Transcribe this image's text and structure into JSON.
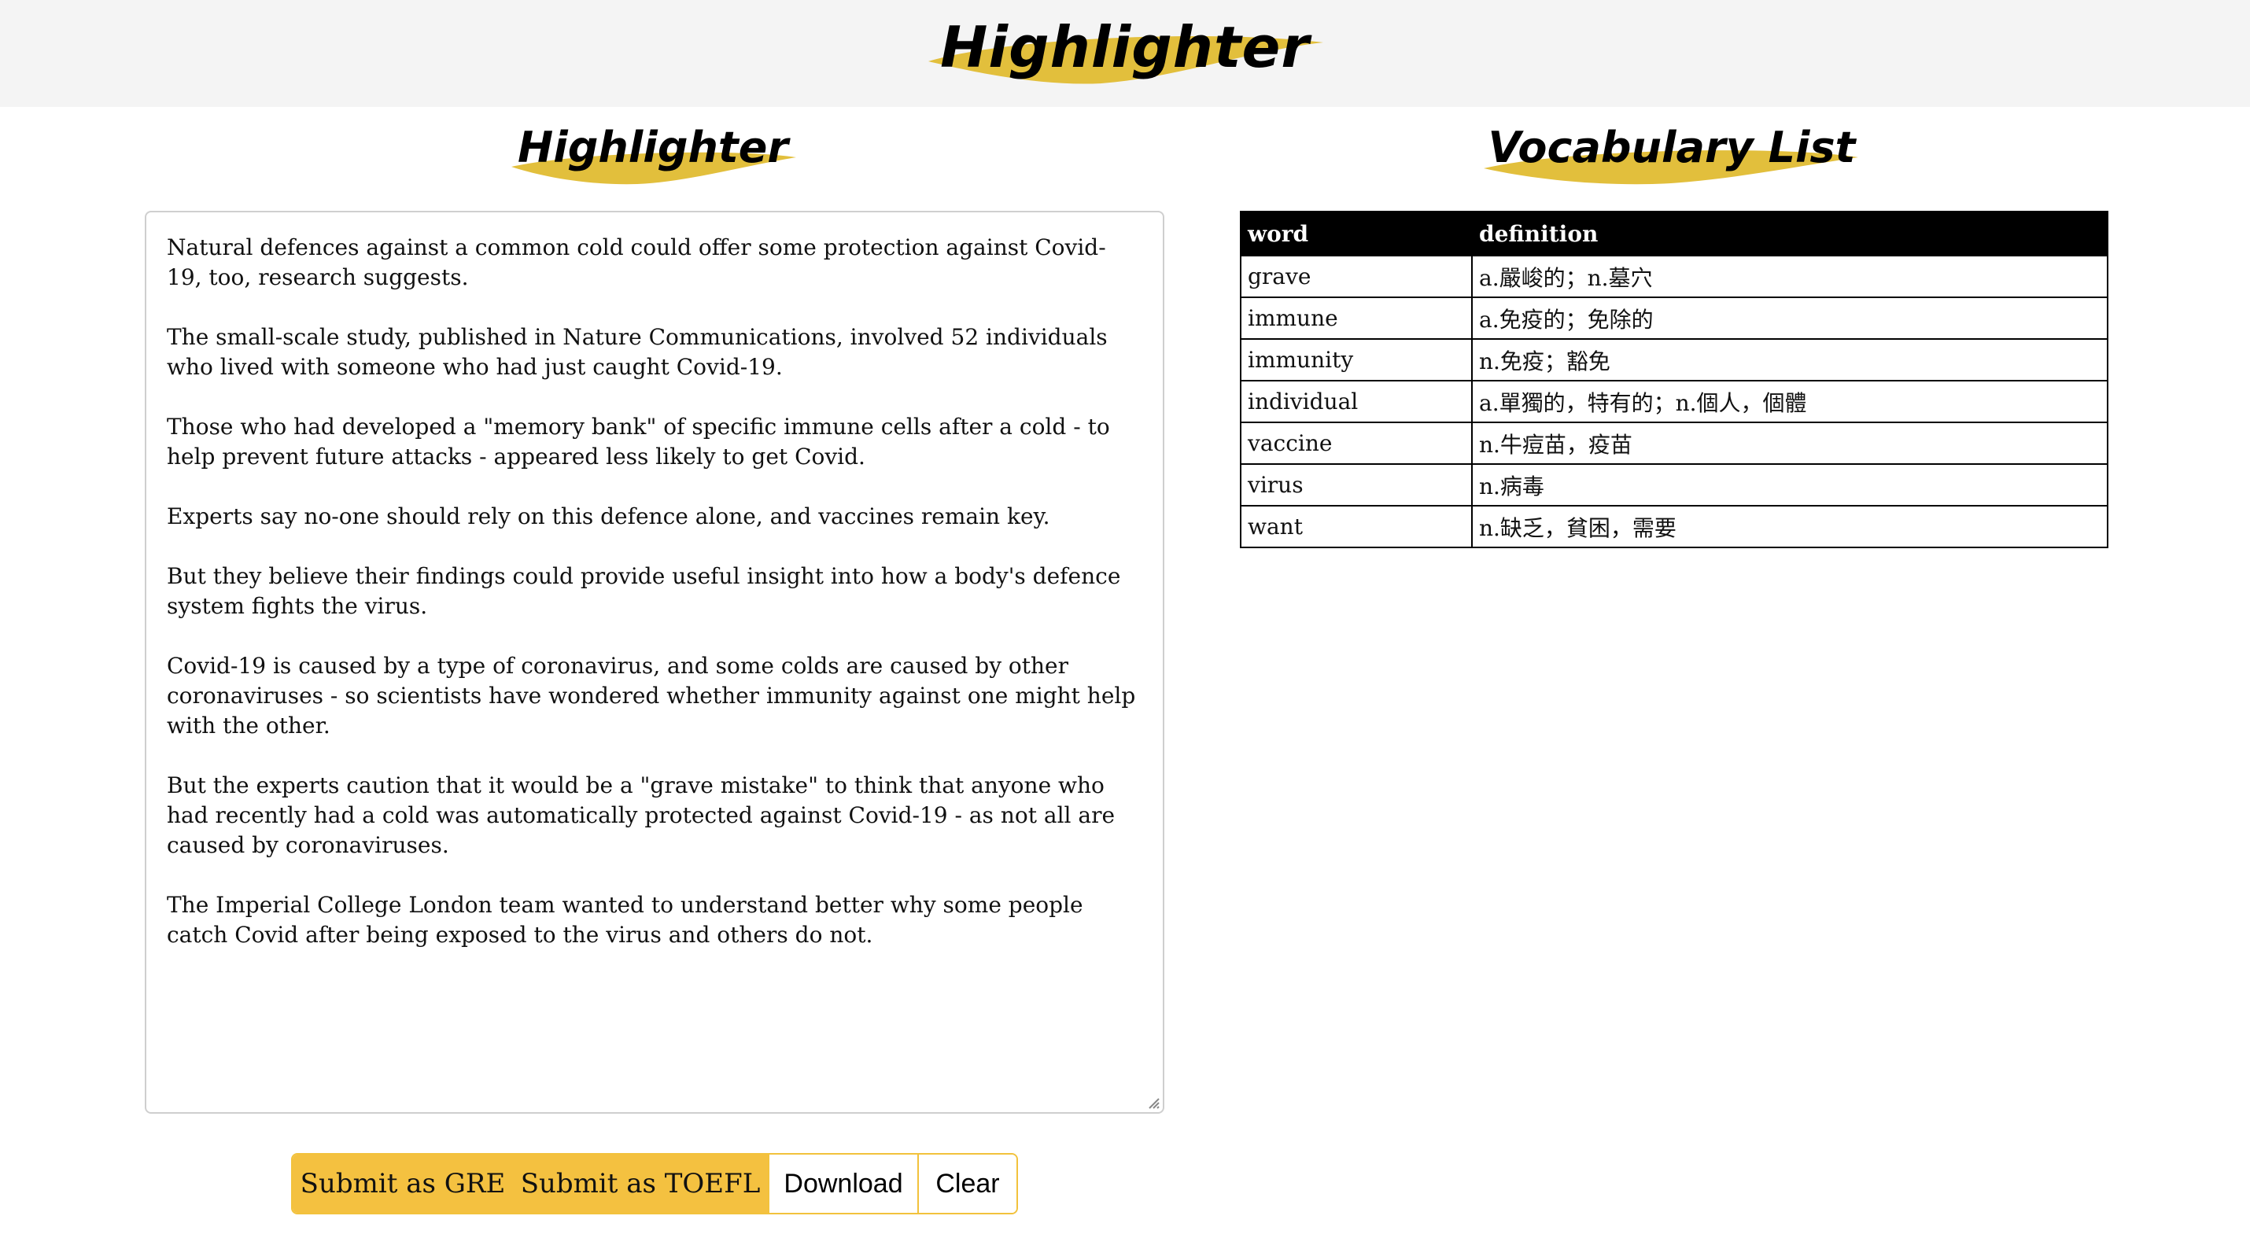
{
  "header": {
    "brand": "Highlighter",
    "accent_color": "#e8c23c",
    "background": "#f4f4f4"
  },
  "editor_panel": {
    "title": "Highlighter",
    "paragraphs": [
      "Natural defences against a common cold could offer some protection against Covid-19, too, research suggests.",
      "The small-scale study, published in Nature Communications, involved 52 individuals who lived with someone who had just caught Covid-19.",
      "Those who had developed a \"memory bank\" of specific immune cells after a cold - to help prevent future attacks - appeared less likely to get Covid.",
      "Experts say no-one should rely on this defence alone, and vaccines remain key.",
      "But they believe their findings could provide useful insight into how a body's defence system fights the virus.",
      "Covid-19 is caused by a type of coronavirus, and some colds are caused by other coronaviruses - so scientists have wondered whether immunity against one might help with the other.",
      "But the experts caution that it would be a \"grave mistake\" to think that anyone who had recently had a cold was automatically protected against Covid-19 - as not all are caused by coronaviruses.",
      "The Imperial College London team wanted to understand better why some people catch Covid after being exposed to the virus and others do not."
    ]
  },
  "vocab_panel": {
    "title": "Vocabulary List",
    "columns": [
      "word",
      "definition"
    ],
    "rows": [
      {
        "word": "grave",
        "definition": "a.嚴峻的；n.墓穴"
      },
      {
        "word": "immune",
        "definition": "a.免疫的；免除的"
      },
      {
        "word": "immunity",
        "definition": "n.免疫；豁免"
      },
      {
        "word": "individual",
        "definition": "a.單獨的，特有的；n.個人，個體"
      },
      {
        "word": "vaccine",
        "definition": "n.牛痘苗，疫苗"
      },
      {
        "word": "virus",
        "definition": "n.病毒"
      },
      {
        "word": "want",
        "definition": "n.缺乏，貧困，需要"
      }
    ]
  },
  "actions": {
    "submit_gre": "Submit as GRE",
    "submit_toefl": "Submit as TOEFL",
    "download": "Download",
    "clear": "Clear",
    "primary_color": "#f4c140"
  }
}
